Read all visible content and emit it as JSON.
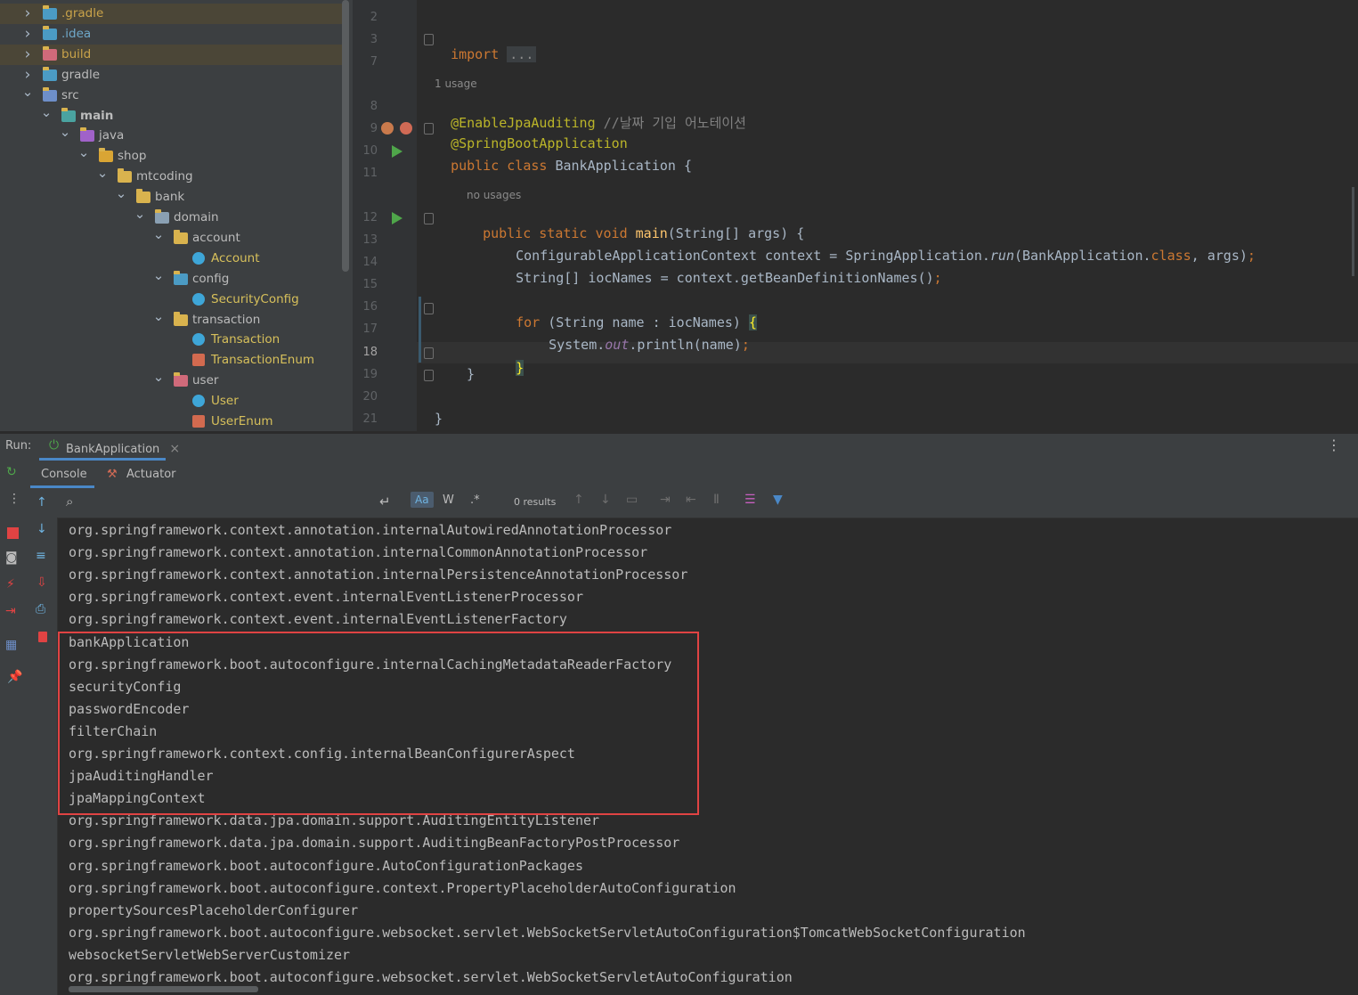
{
  "project_tree": {
    "items": [
      {
        "label": ".gradle",
        "style": "gold",
        "highlight": true,
        "expanded": false,
        "icon": "gradle-folder-icon"
      },
      {
        "label": ".idea",
        "style": "teal",
        "highlight": false,
        "expanded": false,
        "icon": "idea-folder-icon"
      },
      {
        "label": "build",
        "style": "gold",
        "highlight": true,
        "expanded": false,
        "icon": "build-folder-icon"
      },
      {
        "label": "gradle",
        "style": "",
        "highlight": false,
        "expanded": false,
        "icon": "gradle-folder-icon"
      },
      {
        "label": "src",
        "style": "",
        "highlight": false,
        "expanded": true,
        "icon": "source-folder-icon"
      },
      {
        "label": "main",
        "style": "bold",
        "highlight": false,
        "expanded": true,
        "icon": "module-folder-icon"
      },
      {
        "label": "java",
        "style": "",
        "highlight": false,
        "expanded": true,
        "icon": "java-source-root-icon"
      },
      {
        "label": "shop",
        "style": "",
        "highlight": false,
        "expanded": true,
        "icon": "package-folder-icon"
      },
      {
        "label": "mtcoding",
        "style": "",
        "highlight": false,
        "expanded": true,
        "icon": "folder-icon"
      },
      {
        "label": "bank",
        "style": "",
        "highlight": false,
        "expanded": true,
        "icon": "folder-icon"
      },
      {
        "label": "domain",
        "style": "",
        "highlight": false,
        "expanded": true,
        "icon": "domain-folder-icon"
      },
      {
        "label": "account",
        "style": "",
        "highlight": false,
        "expanded": true,
        "icon": "folder-icon"
      },
      {
        "label": "Account",
        "style": "yel",
        "highlight": false,
        "expanded": null,
        "icon": "class-icon"
      },
      {
        "label": "config",
        "style": "",
        "highlight": false,
        "expanded": true,
        "icon": "config-folder-icon"
      },
      {
        "label": "SecurityConfig",
        "style": "yel",
        "highlight": false,
        "expanded": null,
        "icon": "class-icon"
      },
      {
        "label": "transaction",
        "style": "",
        "highlight": false,
        "expanded": true,
        "icon": "folder-icon"
      },
      {
        "label": "Transaction",
        "style": "yel",
        "highlight": false,
        "expanded": null,
        "icon": "class-icon"
      },
      {
        "label": "TransactionEnum",
        "style": "yel",
        "highlight": false,
        "expanded": null,
        "icon": "enum-icon"
      },
      {
        "label": "user",
        "style": "",
        "highlight": false,
        "expanded": true,
        "icon": "user-folder-icon"
      },
      {
        "label": "User",
        "style": "yel",
        "highlight": false,
        "expanded": null,
        "icon": "class-icon"
      },
      {
        "label": "UserEnum",
        "style": "yel",
        "highlight": false,
        "expanded": null,
        "icon": "enum-icon"
      }
    ]
  },
  "editor": {
    "line_numbers": [
      "2",
      "3",
      "7",
      "8",
      "9",
      "10",
      "11",
      "12",
      "13",
      "14",
      "15",
      "16",
      "17",
      "18",
      "19",
      "20",
      "21"
    ],
    "current_line": "18",
    "hints": {
      "usage": "1 usage",
      "no_usages": "no usages"
    }
  },
  "run": {
    "label": "Run:",
    "config_name": "BankApplication",
    "close_glyph": "×",
    "tabs": [
      "Console",
      "Actuator"
    ],
    "search": {
      "placeholder": "",
      "results": "0 results",
      "match_case": "Aa",
      "words": "W",
      "regex": ".*"
    }
  },
  "console_lines": [
    "org.springframework.context.annotation.internalAutowiredAnnotationProcessor",
    "org.springframework.context.annotation.internalCommonAnnotationProcessor",
    "org.springframework.context.annotation.internalPersistenceAnnotationProcessor",
    "org.springframework.context.event.internalEventListenerProcessor",
    "org.springframework.context.event.internalEventListenerFactory",
    "bankApplication",
    "org.springframework.boot.autoconfigure.internalCachingMetadataReaderFactory",
    "securityConfig",
    "passwordEncoder",
    "filterChain",
    "org.springframework.context.config.internalBeanConfigurerAspect",
    "jpaAuditingHandler",
    "jpaMappingContext",
    "org.springframework.data.jpa.domain.support.AuditingEntityListener",
    "org.springframework.data.jpa.domain.support.AuditingBeanFactoryPostProcessor",
    "org.springframework.boot.autoconfigure.AutoConfigurationPackages",
    "org.springframework.boot.autoconfigure.context.PropertyPlaceholderAutoConfiguration",
    "propertySourcesPlaceholderConfigurer",
    "org.springframework.boot.autoconfigure.websocket.servlet.WebSocketServletAutoConfiguration$TomcatWebSocketConfiguration",
    "websocketServletWebServerCustomizer",
    "org.springframework.boot.autoconfigure.websocket.servlet.WebSocketServletAutoConfiguration"
  ],
  "code": {
    "l3_kw": "import",
    "l3_fold": "...",
    "l8_ann": "@EnableJpaAuditing",
    "l8_cmt": "//날짜 기입 어노테이션",
    "l9_ann": "@SpringBootApplication",
    "l10_kw1": "public",
    "l10_kw2": "class",
    "l10_rest": "BankApplication {",
    "l12_kw": "public static void",
    "l12_fn": "main",
    "l12_rest": "(String[] args) {",
    "l13_a": "ConfigurableApplicationContext context = SpringApplication.",
    "l13_run": "run",
    "l13_b": "(BankApplication.",
    "l13_class": "class",
    "l13_c": ", args)",
    "l13_semi": ";",
    "l14": "String[] iocNames = context.getBeanDefinitionNames()",
    "l14_semi": ";",
    "l16_for": "for",
    "l16_rest": "(String name : iocNames)",
    "l16_brace": "{",
    "l17_a": "System.",
    "l17_out": "out",
    "l17_b": ".println(name)",
    "l17_semi": ";",
    "l18": "}",
    "l19": "}",
    "l21": "}"
  },
  "colors": {
    "keyword": "#cc7832",
    "annotation": "#bbb529",
    "highlight_box": "#e04343",
    "run_green": "#4fa64a"
  }
}
